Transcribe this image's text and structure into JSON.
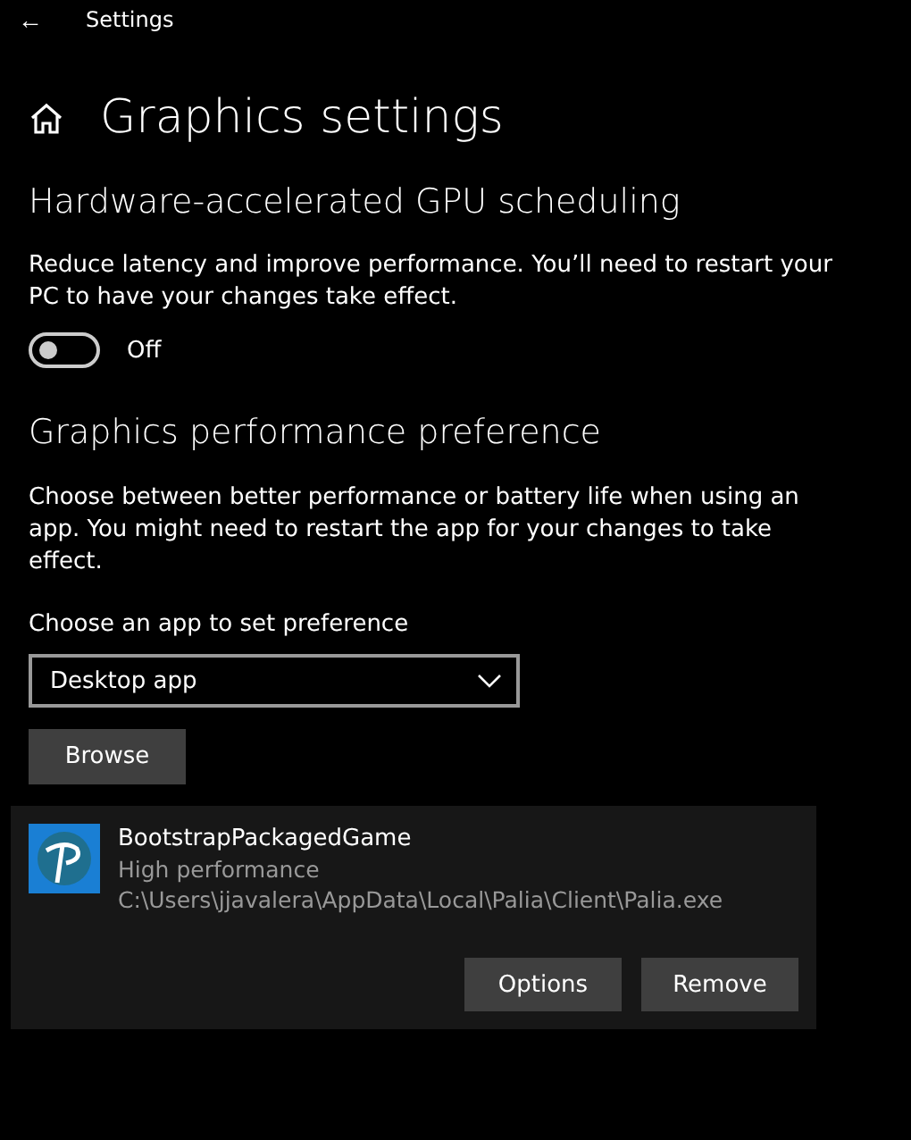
{
  "window": {
    "title": "Settings",
    "back_glyph": "←"
  },
  "page": {
    "title": "Graphics settings"
  },
  "gpu_scheduling": {
    "heading": "Hardware-accelerated GPU scheduling",
    "description": "Reduce latency and improve performance. You’ll need to restart your PC to have your changes take effect.",
    "toggle": {
      "on": false,
      "label": "Off"
    }
  },
  "preference": {
    "heading": "Graphics performance preference",
    "description": "Choose between better performance or battery life when using an app. You might need to restart the app for your changes to take effect.",
    "dropdown_label": "Choose an app to set preference",
    "dropdown_value": "Desktop app",
    "browse_button": "Browse",
    "apps": [
      {
        "name": "BootstrapPackagedGame",
        "preference": "High performance",
        "path": "C:\\Users\\jjavalera\\AppData\\Local\\Palia\\Client\\Palia.exe",
        "selected": true,
        "buttons": [
          "Options",
          "Remove"
        ]
      }
    ]
  }
}
